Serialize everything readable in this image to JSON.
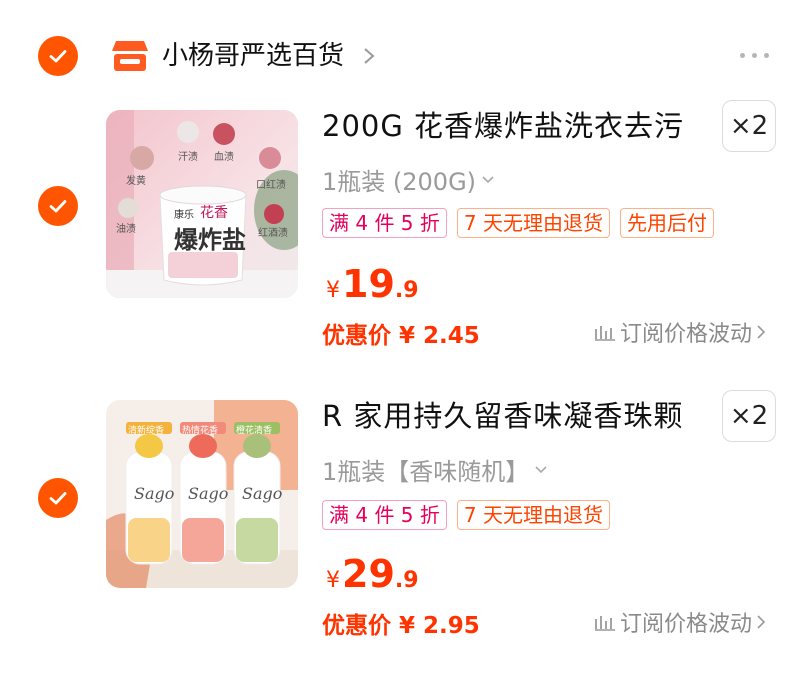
{
  "shop": {
    "name": "小杨哥严选百货",
    "selected": true
  },
  "colors": {
    "accent": "#ff5500",
    "price": "#ff3300",
    "tag_pink": "#e6005c",
    "tag_orange": "#ff4400"
  },
  "items": [
    {
      "title": "200G 花香爆炸盐洗衣去污",
      "quantity": "×2",
      "spec": "1瓶装 (200G)",
      "tags": [
        {
          "text": "满 4 件 5 折",
          "style": "pink"
        },
        {
          "text": "7 天无理由退货",
          "style": "orange"
        },
        {
          "text": "先用后付",
          "style": "orange"
        }
      ],
      "price_currency": "¥",
      "price_int": "19",
      "price_dec": ".9",
      "promo_label": "优惠价 ¥ 2.45",
      "watch_label": "订阅价格波动",
      "image": {
        "product_label": "花香",
        "product_name": "爆炸盐",
        "brand": "康乐",
        "stain_labels": [
          "发黄",
          "汗渍",
          "血渍",
          "口红渍",
          "油渍",
          "红酒渍"
        ]
      }
    },
    {
      "title": "R 家用持久留香味凝香珠颗",
      "quantity": "×2",
      "spec": "1瓶装【香味随机】",
      "tags": [
        {
          "text": "满 4 件 5 折",
          "style": "pink"
        },
        {
          "text": "7 天无理由退货",
          "style": "orange"
        }
      ],
      "price_currency": "¥",
      "price_int": "29",
      "price_dec": ".9",
      "promo_label": "优惠价 ¥ 2.95",
      "watch_label": "订阅价格波动",
      "image": {
        "brand": "Sago",
        "bottle_labels": [
          "清新绽香",
          "热情花香",
          "橙花清香"
        ]
      }
    }
  ]
}
